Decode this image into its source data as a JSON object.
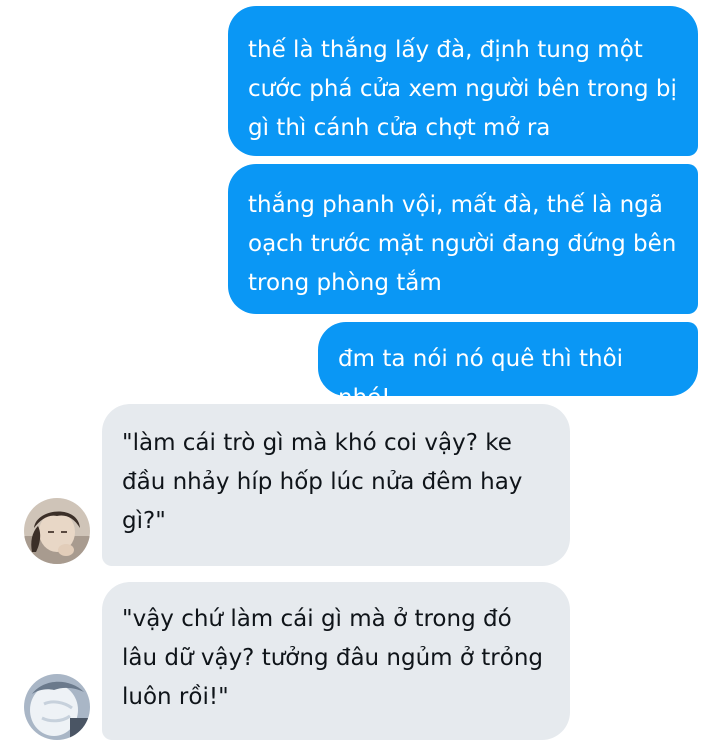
{
  "conversation": {
    "messages": [
      {
        "sender": "self",
        "text": "thế là thắng lấy đà, định tung một\ncước phá cửa xem người bên trong bị\ngì thì cánh cửa chợt mở ra"
      },
      {
        "sender": "self",
        "text": "thắng phanh vội, mất đà, thế là ngã\noạch trước mặt người đang đứng bên\ntrong phòng tắm"
      },
      {
        "sender": "self",
        "text": "đm ta nói nó quê thì thôi nhé!"
      },
      {
        "sender": "other",
        "text": "\"làm cái trò gì mà khó coi vậy? ke\nđầu nhảy híp hốp lúc nửa đêm hay\ngì?\""
      },
      {
        "sender": "other",
        "text": "\"vậy chứ làm cái gì mà ở trong đó\nlâu dữ vậy? tưởng đâu ngủm ở trỏng\nluôn rồi!\""
      }
    ]
  },
  "colors": {
    "outgoing_bubble": "#0a97f5",
    "incoming_bubble": "#e6eaee",
    "outgoing_text": "#ffffff",
    "incoming_text": "#0f1419"
  }
}
